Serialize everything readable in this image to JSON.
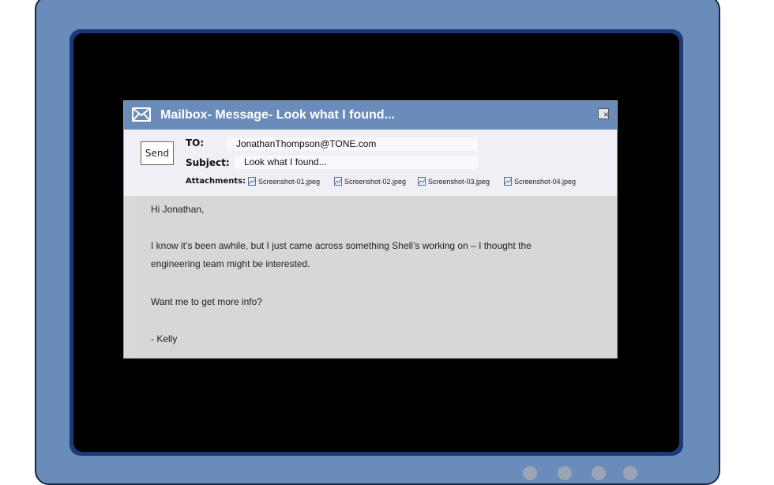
{
  "window": {
    "title": "Mailbox- Message- Look what I found...",
    "close_label": "×"
  },
  "header": {
    "send_label": "Send",
    "to_label": "TO:",
    "to_value": "JonathanThompson@TONE.com",
    "subject_label": "Subject:",
    "subject_value": "Look what I found...",
    "attachments_label": "Attachments:",
    "attachments": [
      "Screenshot-01.jpeg",
      "Screenshot-02.jpeg",
      "Screenshot-03.jpeg",
      "Screenshot-04.jpeg"
    ]
  },
  "body": {
    "greeting": "Hi Jonathan,",
    "line1": "I know it’s been awhile, but I just came across something Shell’s working on – I thought the",
    "line2": "engineering team might be interested.",
    "line3": "Want me to get more info?",
    "signature": "- Kelly"
  },
  "colors": {
    "titlebar": "#6a8cba",
    "monitor": "#6a8cba",
    "bezel": "#1a3a78"
  },
  "icons": {
    "title": "envelope-icon",
    "attachment": "image-file-icon"
  }
}
